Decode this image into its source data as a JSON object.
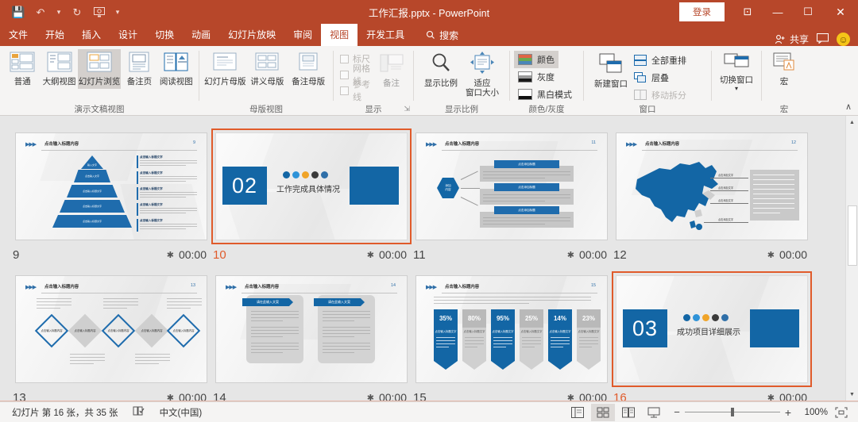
{
  "titlebar": {
    "document_title": "工作汇报.pptx  -  PowerPoint",
    "quick_access": [
      {
        "name": "save",
        "glyph": "💾"
      },
      {
        "name": "undo",
        "glyph": "↶"
      },
      {
        "name": "redo",
        "glyph": "↻"
      },
      {
        "name": "start-slideshow",
        "glyph": "⬜"
      },
      {
        "name": "customize-qat",
        "glyph": "▾"
      }
    ],
    "signin_label": "登录",
    "ribbon_display_glyph": "⊡",
    "minimize_glyph": "—",
    "maximize_glyph": "☐",
    "close_glyph": "✕"
  },
  "tabs": [
    {
      "label": "文件",
      "active": false
    },
    {
      "label": "开始",
      "active": false
    },
    {
      "label": "插入",
      "active": false
    },
    {
      "label": "设计",
      "active": false
    },
    {
      "label": "切换",
      "active": false
    },
    {
      "label": "动画",
      "active": false
    },
    {
      "label": "幻灯片放映",
      "active": false
    },
    {
      "label": "审阅",
      "active": false
    },
    {
      "label": "视图",
      "active": true
    },
    {
      "label": "开发工具",
      "active": false
    }
  ],
  "search": {
    "label": "搜索",
    "icon": "search-icon"
  },
  "share": {
    "label": "共享",
    "icon": "person-add-icon"
  },
  "comments": {
    "icon": "comment-icon"
  },
  "account_face": {
    "icon": "smiley-icon",
    "glyph": "☺"
  },
  "ribbon": {
    "groups": [
      {
        "name": "presentation-views",
        "label": "演示文稿视图",
        "buttons": [
          {
            "label": "普通",
            "selected": false
          },
          {
            "label": "大纲视图",
            "selected": false
          },
          {
            "label": "幻灯片浏览",
            "selected": true
          },
          {
            "label": "备注页",
            "selected": false
          },
          {
            "label": "阅读视图",
            "selected": false
          }
        ]
      },
      {
        "name": "master-views",
        "label": "母版视图",
        "buttons": [
          {
            "label": "幻灯片母版",
            "selected": false
          },
          {
            "label": "讲义母版",
            "selected": false
          },
          {
            "label": "备注母版",
            "selected": false
          }
        ]
      },
      {
        "name": "show",
        "label": "显示",
        "checkboxes": [
          {
            "label": "标尺",
            "checked": false
          },
          {
            "label": "网格线",
            "checked": false
          },
          {
            "label": "参考线",
            "checked": false
          }
        ],
        "buttons": [
          {
            "label": "备注",
            "selected": false
          }
        ],
        "dialog_launcher": "⤵"
      },
      {
        "name": "zoom",
        "label": "显示比例",
        "buttons": [
          {
            "label": "显示比例",
            "label2": "",
            "selected": false
          },
          {
            "label": "适应",
            "label2": "窗口大小",
            "selected": false
          }
        ]
      },
      {
        "name": "color-grayscale",
        "label": "颜色/灰度",
        "rows": [
          {
            "label": "颜色",
            "selected": true
          },
          {
            "label": "灰度",
            "selected": false
          },
          {
            "label": "黑白模式",
            "selected": false
          }
        ]
      },
      {
        "name": "window",
        "label": "窗口",
        "buttons": [
          {
            "label": "新建窗口",
            "selected": false
          }
        ],
        "rows": [
          {
            "label": "全部重排",
            "dim": false
          },
          {
            "label": "层叠",
            "dim": false
          },
          {
            "label": "移动拆分",
            "dim": true
          }
        ],
        "buttons2": [
          {
            "label": "切换窗口",
            "label2": "▾",
            "selected": false
          }
        ]
      },
      {
        "name": "macros",
        "label": "宏",
        "buttons": [
          {
            "label": "宏",
            "selected": false
          }
        ]
      }
    ],
    "collapse_glyph": "∧"
  },
  "slides": [
    {
      "number": "9",
      "time": "00:00",
      "selected": false,
      "type": "pyramid",
      "header_title": "点击输入标题内容",
      "header_num": "9",
      "pyramid_levels": [
        "输入文字",
        "点击输入文字",
        "点击输入标题文字",
        "点击输入标题文字",
        "点击输入标题文字"
      ],
      "side_items": [
        "点击输入标题文字",
        "点击输入标题文字",
        "点击输入标题文字",
        "点击输入标题文字",
        "点击输入标题文字"
      ]
    },
    {
      "number": "10",
      "time": "00:00",
      "selected": true,
      "type": "section",
      "section_number": "02",
      "section_title": "工作完成具体情况",
      "icon_colors": [
        "#1366a5",
        "#2f93d8",
        "#f0a429",
        "#3a3a3a",
        "#2f6fa8"
      ]
    },
    {
      "number": "11",
      "time": "00:00",
      "selected": false,
      "type": "hexflow",
      "header_title": "点击输入标题内容",
      "header_num": "11",
      "hex_label": "添加\n内容",
      "branches": [
        {
          "title": "点击添加标题",
          "body": "单击此处添加文字单击此处添加文字单击此处添加文字"
        },
        {
          "title": "点击添加标题",
          "body": "单击此处添加文字单击此处添加文字单击此处添加文字"
        },
        {
          "title": "点击添加标题",
          "body": "单击此处添加文字单击此处添加文字单击此处添加文字"
        }
      ]
    },
    {
      "number": "12",
      "time": "00:00",
      "selected": false,
      "type": "map",
      "header_title": "点击输入标题内容",
      "header_num": "12",
      "callout_labels": [
        "点击添加文字",
        "点击添加文字",
        "点击添加文字",
        "点击添加文字"
      ]
    },
    {
      "number": "13",
      "time": "00:00",
      "selected": false,
      "type": "diamonds",
      "header_title": "点击输入标题内容",
      "header_num": "13",
      "diamond_labels": [
        "点击输入标题内容",
        "点击输入标题内容",
        "点击输入标题内容",
        "点击输入标题内容",
        "点击输入标题内容"
      ]
    },
    {
      "number": "14",
      "time": "00:00",
      "selected": false,
      "type": "twoboxes",
      "header_title": "点击输入标题内容",
      "header_num": "14",
      "box_titles": [
        "请在此输入文案",
        "请在此输入文案"
      ]
    },
    {
      "number": "15",
      "time": "00:00",
      "selected": false,
      "type": "percent",
      "header_title": "点击输入标题内容",
      "header_num": "15",
      "percents": [
        "35%",
        "80%",
        "95%",
        "25%",
        "14%",
        "23%"
      ],
      "percent_colors": [
        "#1366a5",
        "#b9b9b9",
        "#1366a5",
        "#b9b9b9",
        "#1366a5",
        "#b9b9b9"
      ],
      "sub_label": "点击输入标题文字"
    },
    {
      "number": "16",
      "time": "00:00",
      "selected": true,
      "type": "section",
      "section_number": "03",
      "section_title": "成功项目详细展示",
      "icon_colors": [
        "#1366a5",
        "#2f93d8",
        "#f0a429",
        "#3a3a3a",
        "#2f6fa8"
      ]
    }
  ],
  "statusbar": {
    "slide_count_text": "幻灯片 第 16 张，共 35 张",
    "proofing_icon": "spellcheck-icon",
    "language": "中文(中国)",
    "view_buttons": [
      {
        "name": "normal-view-button",
        "selected": false
      },
      {
        "name": "slide-sorter-view-button",
        "selected": true
      },
      {
        "name": "reading-view-button",
        "selected": false
      },
      {
        "name": "slideshow-button",
        "selected": false
      }
    ],
    "zoom_out_glyph": "−",
    "zoom_in_glyph": "+",
    "zoom_level": "100%",
    "fit_window_icon": "fit-slide-icon"
  },
  "colors": {
    "ribbon_accent": "#b7472a",
    "selection": "#e05b2b",
    "slide_blue": "#1366a5"
  }
}
